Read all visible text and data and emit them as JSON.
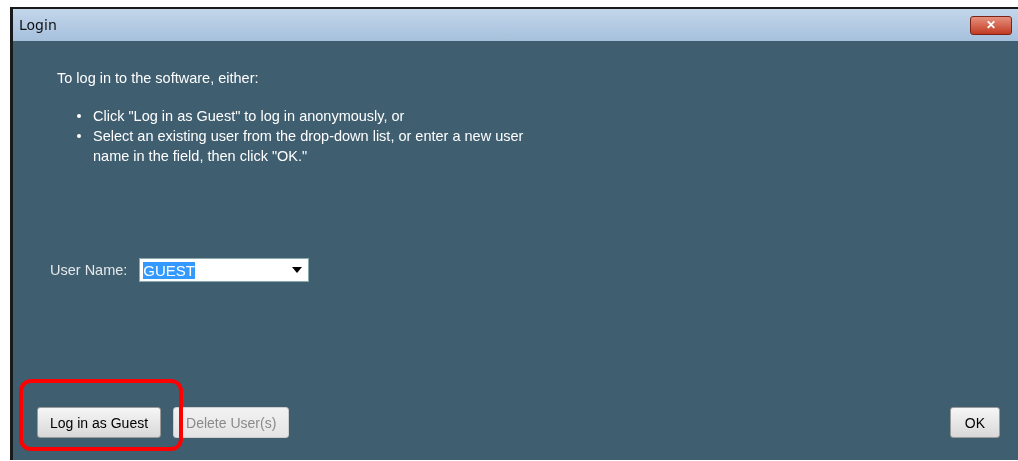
{
  "window": {
    "title": "Login",
    "close": "✕"
  },
  "intro": "To log in to the software, either:",
  "bullets": [
    "Click \"Log in as Guest\" to log in anonymously, or",
    "Select an existing user from the drop-down list, or enter a new user name in the field, then click \"OK.\""
  ],
  "user_name": {
    "label": "User Name:",
    "value": "GUEST",
    "text_selected": true
  },
  "buttons": [
    {
      "label": "Log in as Guest",
      "disabled": false,
      "highlighted": true
    },
    {
      "label": "Delete User(s)",
      "disabled": true,
      "highlighted": false
    }
  ],
  "ok_button": {
    "label": "OK",
    "disabled": false
  }
}
